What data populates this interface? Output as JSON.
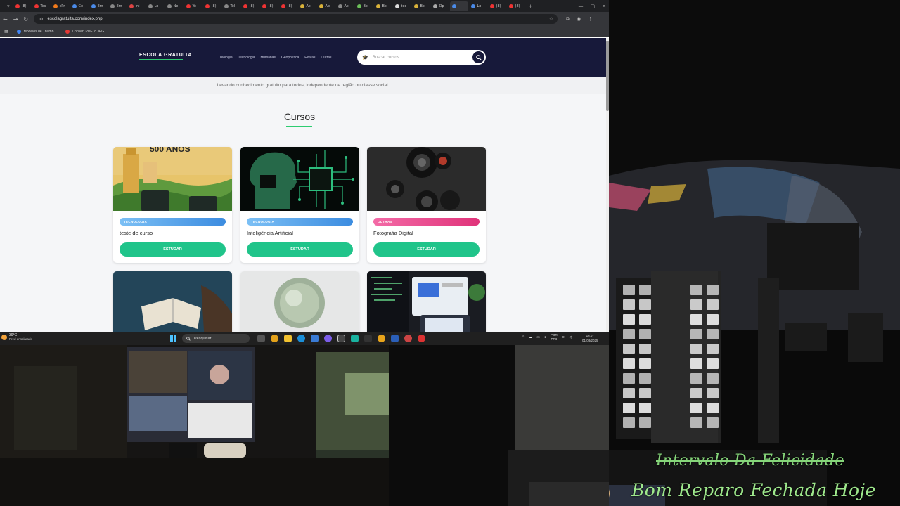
{
  "browser": {
    "tabs": [
      "(8)",
      "Tes",
      "cPr",
      "Cé",
      "Em",
      "Em",
      "Ini",
      "Lo",
      "Ne",
      "Yo",
      "(8)",
      "Tel",
      "(8)",
      "(8)",
      "(8)",
      "Ac",
      "Ab",
      "Ac",
      "Bc",
      "Bc",
      "tec",
      "Bc",
      "Op",
      "",
      "Lo",
      "(8)",
      "(8)"
    ],
    "active_tab_index": 23,
    "new_tab": "+",
    "url": "escolagratuita.com/index.php",
    "bookmarks": [
      {
        "label": "Modelos de Thumb...",
        "color": "#4285f4"
      },
      {
        "label": "Convert PDF to JPG...",
        "color": "#e53935"
      }
    ]
  },
  "site": {
    "logo": "ESCOLA GRATUITA",
    "nav": [
      "Teologia",
      "Tecnologia",
      "Humanas",
      "Geopolítica",
      "Exatas",
      "Outras"
    ],
    "search_placeholder": "Buscar cursos...",
    "tagline": "Levando conhecimento gratuito para todos, independente de região ou classe social.",
    "section_title": "Cursos",
    "cards": [
      {
        "category": "TECNOLOGIA",
        "title": "teste de curso",
        "button": "ESTUDAR",
        "badge_color": "#4a9be8",
        "image_text": "500 ANOS"
      },
      {
        "category": "TECNOLOGIA",
        "title": "Inteligência Artificial",
        "button": "ESTUDAR",
        "badge_color": "#4a9be8"
      },
      {
        "category": "OUTRAS",
        "title": "Fotografia Digital",
        "button": "ESTUDAR",
        "badge_color": "#e83e8c"
      }
    ]
  },
  "taskbar": {
    "weather_temp": "39°C",
    "weather_condition": "Pred ensolarado",
    "search_label": "Pesquisar",
    "lang_top": "POR",
    "lang_bottom": "PTB",
    "time": "16:07",
    "date": "01/08/2025"
  },
  "overlay": {
    "line1": "Intervalo Da Felicidade",
    "line2": "Bom Reparo Fechada Hoje"
  }
}
